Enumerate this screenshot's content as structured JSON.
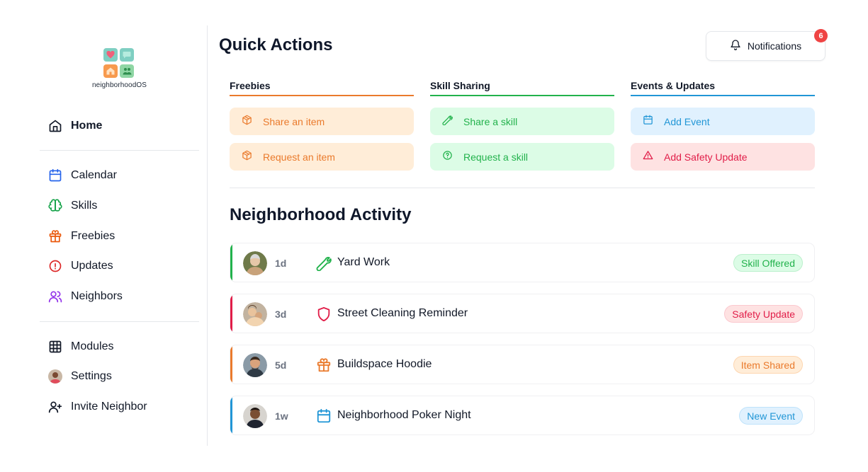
{
  "app": {
    "name": "neighborhoodOS"
  },
  "colors": {
    "orange": "#ea7a2c",
    "orange_bg": "#ffedd8",
    "green": "#22b24c",
    "green_bg": "#dcfce6",
    "blue": "#2196d6",
    "blue_bg": "#e0f1fe",
    "red": "#e11d48",
    "red_bg": "#fee2e2",
    "purple": "#9333ea"
  },
  "sidebar": {
    "items": [
      {
        "label": "Home",
        "icon": "home-icon",
        "active": true
      },
      {
        "label": "Calendar",
        "icon": "calendar-icon"
      },
      {
        "label": "Skills",
        "icon": "brain-icon"
      },
      {
        "label": "Freebies",
        "icon": "gift-icon"
      },
      {
        "label": "Updates",
        "icon": "info-icon"
      },
      {
        "label": "Neighbors",
        "icon": "users-icon"
      },
      {
        "label": "Modules",
        "icon": "grid-icon"
      },
      {
        "label": "Settings",
        "icon": "avatar-icon"
      },
      {
        "label": "Invite Neighbor",
        "icon": "user-plus-icon"
      }
    ]
  },
  "header": {
    "title": "Quick Actions",
    "notifications_label": "Notifications",
    "notifications_count": "6"
  },
  "quick_actions": [
    {
      "heading": "Freebies",
      "buttons": [
        {
          "label": "Share an item",
          "icon": "package-icon"
        },
        {
          "label": "Request an item",
          "icon": "package-icon"
        }
      ]
    },
    {
      "heading": "Skill Sharing",
      "buttons": [
        {
          "label": "Share a skill",
          "icon": "wrench-icon"
        },
        {
          "label": "Request a skill",
          "icon": "question-circle-icon"
        }
      ]
    },
    {
      "heading": "Events & Updates",
      "buttons": [
        {
          "label": "Add Event",
          "icon": "calendar-icon"
        },
        {
          "label": "Add Safety Update",
          "icon": "warning-icon"
        }
      ]
    }
  ],
  "activity": {
    "title": "Neighborhood Activity",
    "items": [
      {
        "time": "1d",
        "title": "Yard Work",
        "tag": "Skill Offered",
        "icon": "wrench-icon"
      },
      {
        "time": "3d",
        "title": "Street Cleaning Reminder",
        "tag": "Safety Update",
        "icon": "shield-icon"
      },
      {
        "time": "5d",
        "title": "Buildspace Hoodie",
        "tag": "Item Shared",
        "icon": "gift-icon"
      },
      {
        "time": "1w",
        "title": "Neighborhood Poker Night",
        "tag": "New Event",
        "icon": "calendar-icon"
      }
    ]
  }
}
